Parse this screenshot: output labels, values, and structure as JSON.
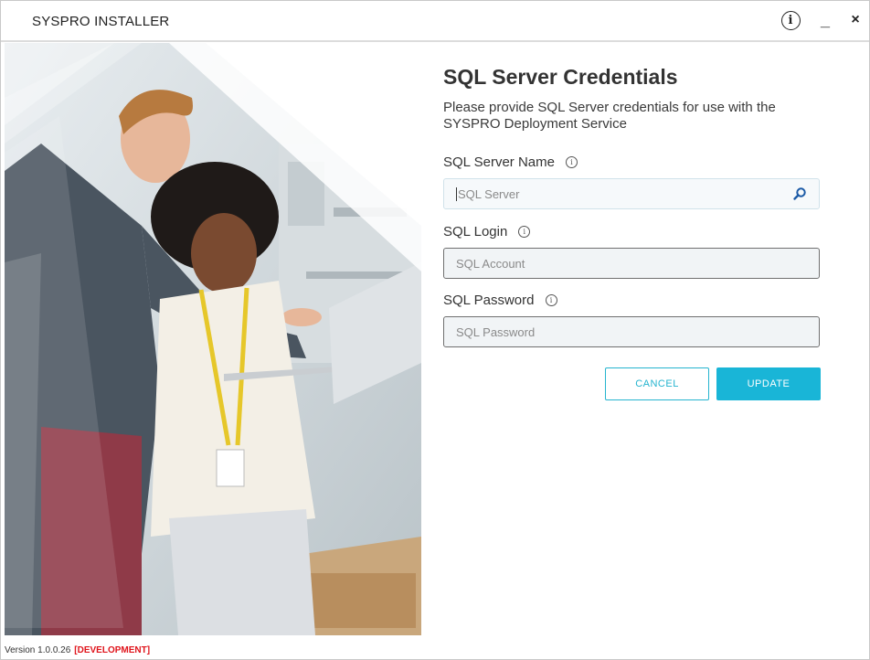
{
  "window": {
    "title": "SYSPRO INSTALLER",
    "info_button": "i",
    "minimize_button": "_",
    "close_button": "×"
  },
  "page": {
    "title": "SQL Server Credentials",
    "subtitle": "Please provide SQL Server credentials for use with the SYSPRO Deployment Service"
  },
  "fields": {
    "server": {
      "label": "SQL Server Name",
      "placeholder": "SQL Server",
      "value": ""
    },
    "login": {
      "label": "SQL Login",
      "placeholder": "SQL Account",
      "value": ""
    },
    "password": {
      "label": "SQL Password",
      "placeholder": "SQL Password",
      "value": ""
    },
    "info_glyph": "i"
  },
  "buttons": {
    "cancel": "CANCEL",
    "update": "UPDATE"
  },
  "footer": {
    "version": "Version 1.0.0.26",
    "environment": "[DEVELOPMENT]"
  },
  "icons": {
    "info": "info-circle-icon",
    "search": "search-icon",
    "minimize": "minimize-icon",
    "close": "close-icon"
  },
  "colors": {
    "accent": "#19b5d7",
    "environment_tag": "#e0141b"
  }
}
